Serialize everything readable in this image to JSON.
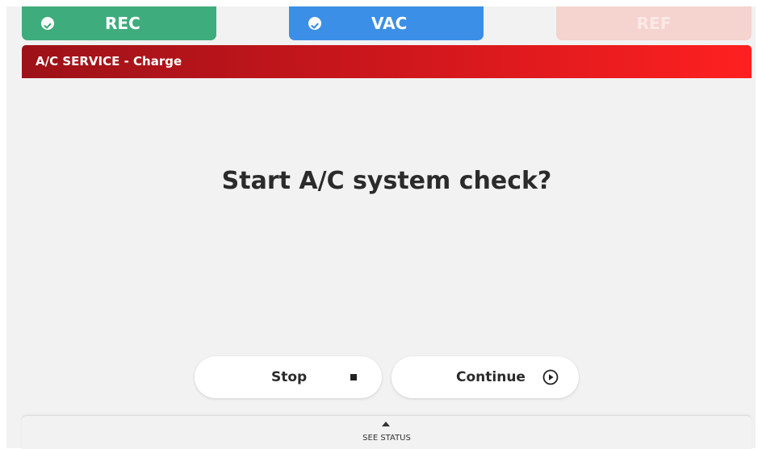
{
  "tabs": [
    {
      "label": "REC",
      "state": "done",
      "color": "#3fac7d",
      "icon": "check-circle-icon"
    },
    {
      "label": "VAC",
      "state": "done",
      "color": "#3b8fe6",
      "icon": "check-circle-icon"
    },
    {
      "label": "REF",
      "state": "pending",
      "color": "#f5d3cf"
    }
  ],
  "header": {
    "title": "A/C SERVICE - Charge",
    "accent_color": "#c8161c"
  },
  "main": {
    "question": "Start A/C system check?"
  },
  "actions": {
    "stop_label": "Stop",
    "stop_icon": "stop-square-icon",
    "continue_label": "Continue",
    "continue_icon": "play-circle-icon"
  },
  "status_panel": {
    "label": "SEE STATUS",
    "icon": "caret-up-icon"
  }
}
